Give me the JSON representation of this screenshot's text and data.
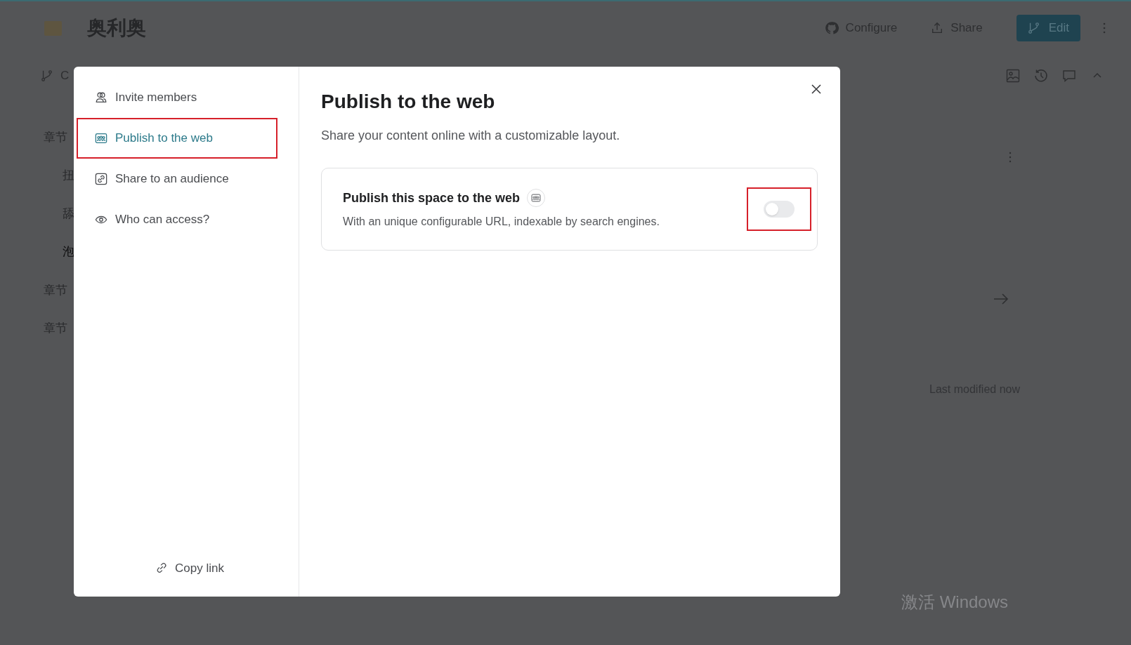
{
  "page": {
    "title": "奥利奥",
    "header_actions": [
      {
        "label": "Configure",
        "kind": "github"
      },
      {
        "label": "Share",
        "kind": "share"
      }
    ],
    "edit_button": "Edit",
    "branch_label": "C",
    "outline": [
      {
        "label": "章节",
        "selected": false,
        "children": [
          {
            "label": "扭",
            "selected": false
          },
          {
            "label": "舔",
            "selected": false
          },
          {
            "label": "泡",
            "selected": true
          }
        ]
      },
      {
        "label": "章节",
        "selected": false
      },
      {
        "label": "章节",
        "selected": false
      }
    ],
    "last_modified": "Last modified now"
  },
  "dialog": {
    "nav": [
      {
        "label": "Invite members",
        "kind": "members",
        "selected": false,
        "highlighted": false
      },
      {
        "label": "Publish to the web",
        "kind": "web",
        "selected": true,
        "highlighted": true
      },
      {
        "label": "Share to an audience",
        "kind": "link",
        "selected": false,
        "highlighted": false
      },
      {
        "label": "Who can access?",
        "kind": "eye",
        "selected": false,
        "highlighted": false
      }
    ],
    "copy_link": "Copy link",
    "title": "Publish to the web",
    "subtitle": "Share your content online with a customizable layout.",
    "card": {
      "title": "Publish this space to the web",
      "description": "With an unique configurable URL, indexable by search engines.",
      "toggle": {
        "on": false,
        "highlighted": true
      }
    }
  },
  "system_overlay": "激活 Windows"
}
